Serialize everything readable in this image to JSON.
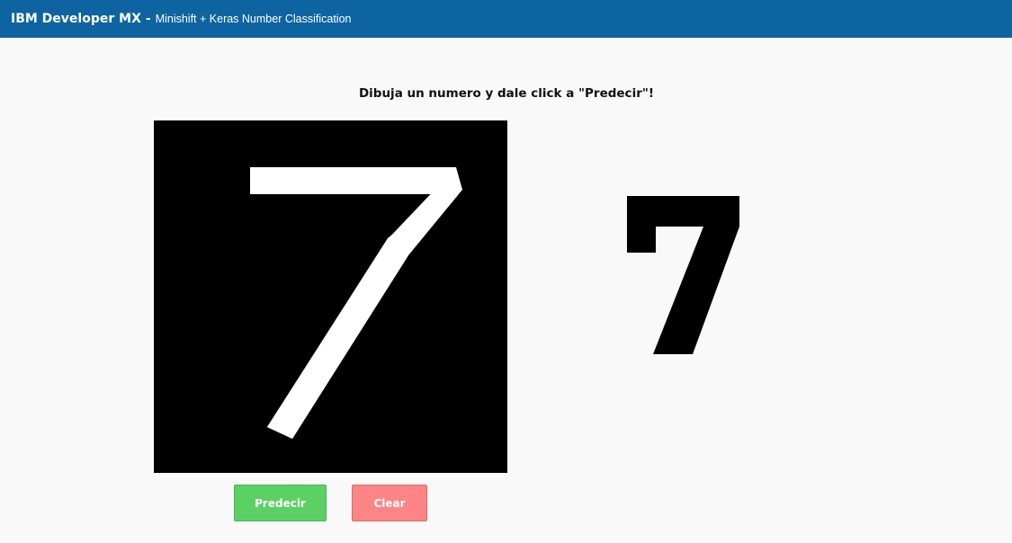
{
  "header": {
    "brand": "IBM Developer MX",
    "separator": "-",
    "subtitle": "Minishift + Keras Number Classification",
    "background_color": "#0e64a1"
  },
  "main": {
    "instruction": "Dibuja un numero y dale click a \"Predecir\"!",
    "prediction": "7"
  },
  "buttons": {
    "predict_label": "Predecir",
    "clear_label": "Clear",
    "predict_color": "#5cd163",
    "clear_color": "#fd8585"
  },
  "icons": {
    "drawn_digit": "hand-drawn-seven-stroke",
    "predicted_digit": "bold-seven-glyph"
  }
}
